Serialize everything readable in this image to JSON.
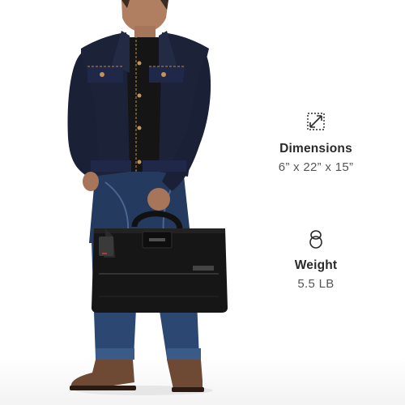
{
  "specs": {
    "dimensions": {
      "label": "Dimensions",
      "value": "6” x 22” x 15”",
      "icon": "dimensions-arrow-icon"
    },
    "weight": {
      "label": "Weight",
      "value": "5.5 LB",
      "icon": "kettlebell-weight-icon"
    }
  },
  "colors": {
    "background": "#ffffff",
    "text": "#2a2a2a",
    "value_text": "#555555"
  }
}
